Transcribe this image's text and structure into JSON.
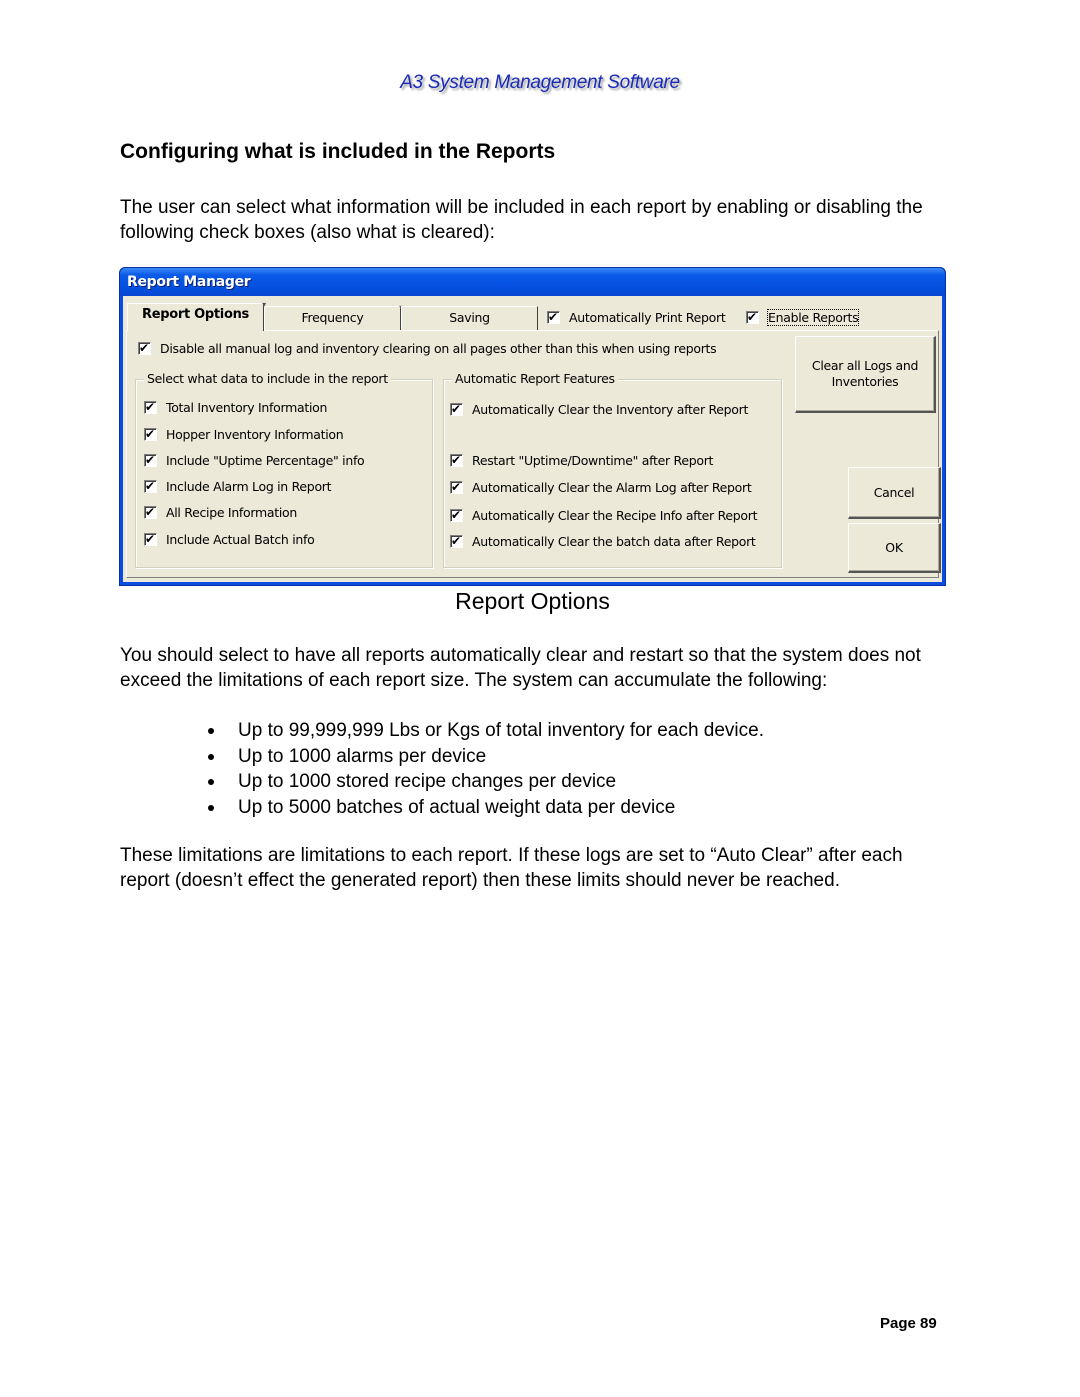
{
  "document": {
    "header": "A3 System Management Software",
    "section_title": "Configuring what is included in the Reports",
    "intro": "The user can select what information will be included in each report by enabling or disabling the following check boxes (also what is cleared):",
    "figure_caption": "Report Options",
    "body_paragraph": "You should select to have all reports automatically clear and restart so that the system does not exceed the limitations of each report size.  The system can accumulate the following:",
    "bullets": [
      "Up to 99,999,999 Lbs or Kgs of total inventory for each device.",
      "Up to 1000 alarms per device",
      "Up to 1000 stored recipe changes per device",
      "Up to 5000 batches of actual weight data per device"
    ],
    "closing_paragraph": "These limitations are limitations to each report.  If these logs are set to “Auto Clear” after each report (doesn’t effect the generated report) then these limits should never be reached.",
    "page_label": "Page 89"
  },
  "dialog": {
    "title": "Report Manager",
    "tabs": [
      {
        "label": "Report Options",
        "active": true
      },
      {
        "label": "Frequency",
        "active": false
      },
      {
        "label": "Saving",
        "active": false
      }
    ],
    "header_checkboxes": [
      {
        "label": "Automatically Print Report",
        "checked": true
      },
      {
        "label": "Enable Reports",
        "checked": true
      }
    ],
    "disable_manual_clearing": {
      "label": "Disable all manual log and inventory clearing on all pages other than this when using reports",
      "checked": true
    },
    "data_group": {
      "legend": "Select what data to include in the report",
      "items": [
        {
          "label": "Total Inventory Information",
          "checked": true
        },
        {
          "label": "Hopper Inventory Information",
          "checked": true
        },
        {
          "label": "Include \"Uptime Percentage\" info",
          "checked": true
        },
        {
          "label": "Include Alarm Log in Report",
          "checked": true
        },
        {
          "label": "All Recipe Information",
          "checked": true
        },
        {
          "label": "Include Actual Batch info",
          "checked": true
        }
      ]
    },
    "auto_group": {
      "legend": "Automatic Report Features",
      "items": [
        {
          "label": "Automatically Clear the Inventory after Report",
          "checked": true
        },
        {
          "label": "Restart \"Uptime/Downtime\" after Report",
          "checked": true
        },
        {
          "label": "Automatically Clear the Alarm Log after Report",
          "checked": true
        },
        {
          "label": "Automatically Clear the Recipe Info after Report",
          "checked": true
        },
        {
          "label": "Automatically Clear the batch data after Report",
          "checked": true
        }
      ]
    },
    "buttons": {
      "clear_all_line1": "Clear all Logs and",
      "clear_all_line2": "Inventories",
      "cancel": "Cancel",
      "ok": "OK"
    },
    "check_glyph": "✔"
  }
}
